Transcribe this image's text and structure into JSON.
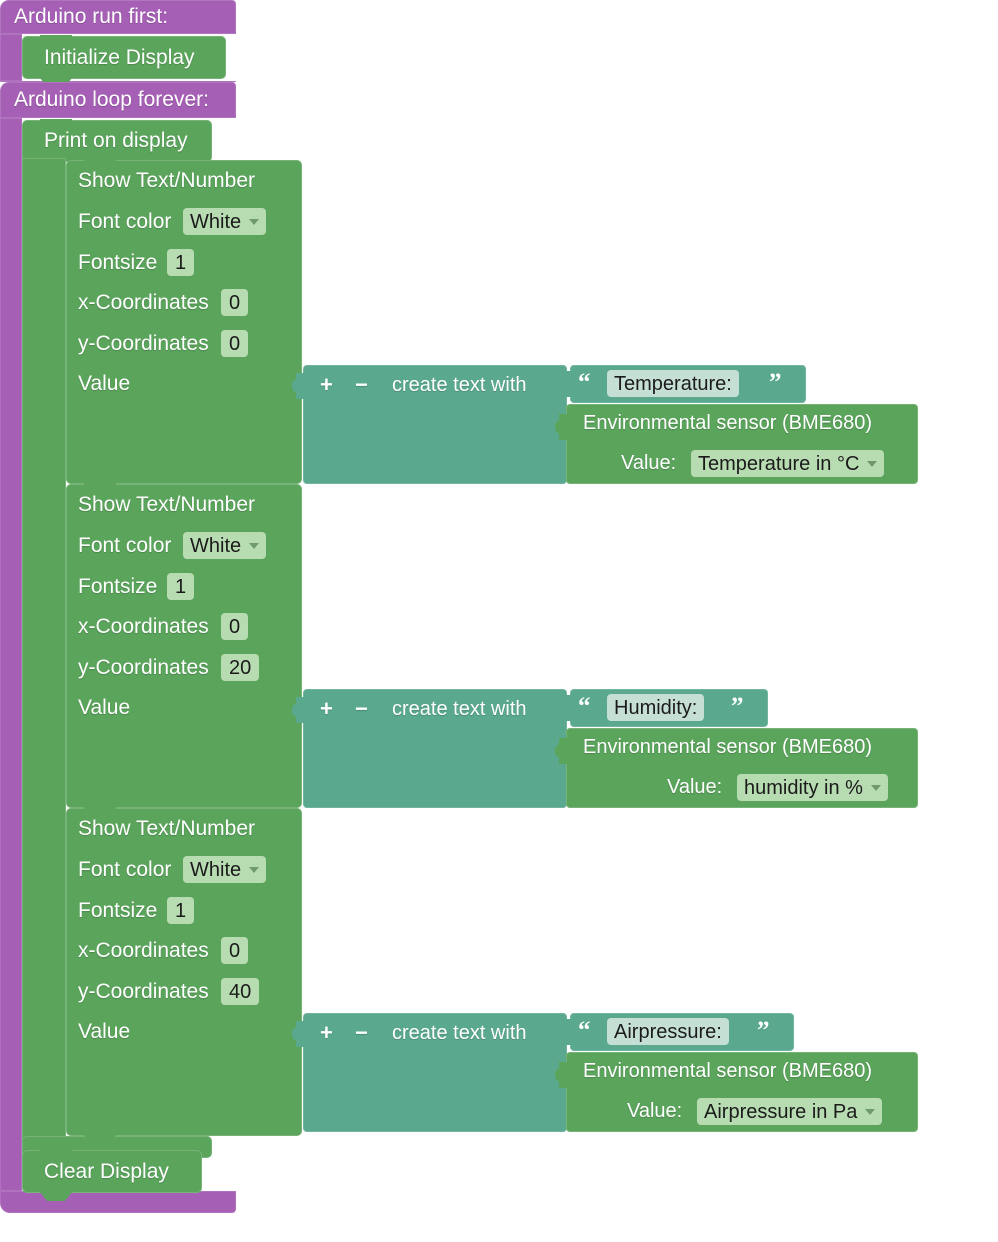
{
  "workspace": {
    "title": "Blockly Arduino Workspace",
    "colors": {
      "event_purple": "#a55fb5",
      "statement_green": "#5ba45c",
      "text_teal": "#5aa98f",
      "field_green": "#b8dcb2",
      "field_teal": "#c6dfd5"
    }
  },
  "setup_block": {
    "label": "Arduino run first:",
    "children": [
      {
        "label": "Initialize Display"
      }
    ]
  },
  "loop_block": {
    "label": "Arduino loop forever:",
    "children": [
      {
        "label": "Print on display"
      },
      {
        "label": "Clear Display"
      }
    ]
  },
  "show_blocks": [
    {
      "title": "Show Text/Number",
      "font_color_label": "Font color",
      "font_color_value": "White",
      "fontsize_label": "Fontsize",
      "fontsize_value": "1",
      "x_label": "x-Coordinates",
      "x_value": "0",
      "y_label": "y-Coordinates",
      "y_value": "0",
      "value_label": "Value",
      "create_text": {
        "plus": "+",
        "minus": "−",
        "label": "create text with",
        "open_quote": "“",
        "close_quote": "”",
        "text_value": "Temperature:",
        "sensor": {
          "title": "Environmental sensor (BME680)",
          "value_label": "Value:",
          "value_selected": "Temperature in °C"
        }
      }
    },
    {
      "title": "Show Text/Number",
      "font_color_label": "Font color",
      "font_color_value": "White",
      "fontsize_label": "Fontsize",
      "fontsize_value": "1",
      "x_label": "x-Coordinates",
      "x_value": "0",
      "y_label": "y-Coordinates",
      "y_value": "20",
      "value_label": "Value",
      "create_text": {
        "plus": "+",
        "minus": "−",
        "label": "create text with",
        "open_quote": "“",
        "close_quote": "”",
        "text_value": "Humidity:",
        "sensor": {
          "title": "Environmental sensor (BME680)",
          "value_label": "Value:",
          "value_selected": "humidity in %"
        }
      }
    },
    {
      "title": "Show Text/Number",
      "font_color_label": "Font color",
      "font_color_value": "White",
      "fontsize_label": "Fontsize",
      "fontsize_value": "1",
      "x_label": "x-Coordinates",
      "x_value": "0",
      "y_label": "y-Coordinates",
      "y_value": "40",
      "value_label": "Value",
      "create_text": {
        "plus": "+",
        "minus": "−",
        "label": "create text with",
        "open_quote": "“",
        "close_quote": "”",
        "text_value": "Airpressure:",
        "sensor": {
          "title": "Environmental sensor (BME680)",
          "value_label": "Value:",
          "value_selected": "Airpressure in Pa"
        }
      }
    }
  ]
}
